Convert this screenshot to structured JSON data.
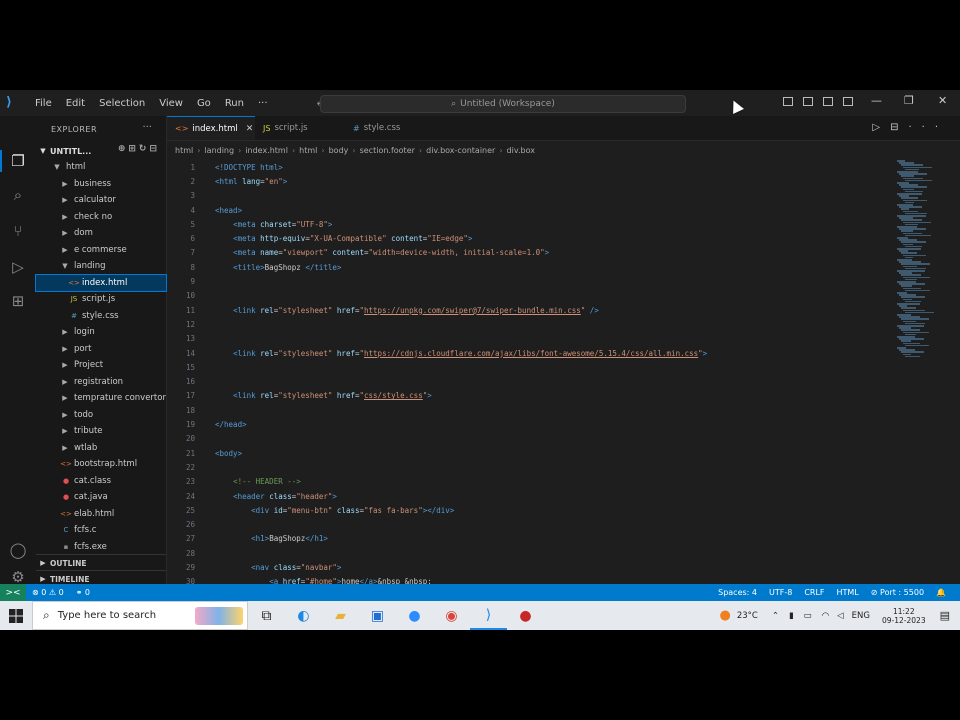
{
  "titlebar": {
    "menu": [
      "File",
      "Edit",
      "Selection",
      "View",
      "Go",
      "Run",
      "···"
    ],
    "command_center": "Untitled (Workspace)",
    "nav_back": "←",
    "nav_fwd": "→"
  },
  "sidebar": {
    "title": "EXPLORER",
    "more": "···",
    "workspace": "UNTITL...",
    "tree": [
      {
        "label": "html",
        "indent": 1,
        "kind": "folder-open"
      },
      {
        "label": "business",
        "indent": 2,
        "kind": "folder"
      },
      {
        "label": "calculator",
        "indent": 2,
        "kind": "folder"
      },
      {
        "label": "check no",
        "indent": 2,
        "kind": "folder"
      },
      {
        "label": "dom",
        "indent": 2,
        "kind": "folder"
      },
      {
        "label": "e commerse",
        "indent": 2,
        "kind": "folder"
      },
      {
        "label": "landing",
        "indent": 2,
        "kind": "folder-open"
      },
      {
        "label": "index.html",
        "indent": 3,
        "kind": "html",
        "selected": true
      },
      {
        "label": "script.js",
        "indent": 3,
        "kind": "js"
      },
      {
        "label": "style.css",
        "indent": 3,
        "kind": "css"
      },
      {
        "label": "login",
        "indent": 2,
        "kind": "folder"
      },
      {
        "label": "port",
        "indent": 2,
        "kind": "folder"
      },
      {
        "label": "Project",
        "indent": 2,
        "kind": "folder"
      },
      {
        "label": "registration",
        "indent": 2,
        "kind": "folder"
      },
      {
        "label": "temprature convertor",
        "indent": 2,
        "kind": "folder"
      },
      {
        "label": "todo",
        "indent": 2,
        "kind": "folder"
      },
      {
        "label": "tribute",
        "indent": 2,
        "kind": "folder"
      },
      {
        "label": "wtlab",
        "indent": 2,
        "kind": "folder"
      },
      {
        "label": "bootstrap.html",
        "indent": 2,
        "kind": "html"
      },
      {
        "label": "cat.class",
        "indent": 2,
        "kind": "class"
      },
      {
        "label": "cat.java",
        "indent": 2,
        "kind": "java"
      },
      {
        "label": "elab.html",
        "indent": 2,
        "kind": "html"
      },
      {
        "label": "fcfs.c",
        "indent": 2,
        "kind": "c"
      },
      {
        "label": "fcfs.exe",
        "indent": 2,
        "kind": "exe"
      }
    ],
    "outline": "OUTLINE",
    "timeline": "TIMELINE"
  },
  "tabs": [
    {
      "label": "index.html",
      "icon": "<>",
      "active": true
    },
    {
      "label": "script.js",
      "icon": "JS",
      "active": false
    },
    {
      "label": "style.css",
      "icon": "#",
      "active": false
    }
  ],
  "breadcrumb": [
    "html",
    "landing",
    "index.html",
    "html",
    "body",
    "section.footer",
    "div.box-container",
    "div.box"
  ],
  "code_lines": [
    {
      "n": "1",
      "html": "<span class='tag'>&lt;!DOCTYPE html&gt;</span>"
    },
    {
      "n": "2",
      "html": "<span class='tag'>&lt;html</span> <span class='attr'>lang</span>=<span class='str'>\"en\"</span><span class='tag'>&gt;</span>"
    },
    {
      "n": "3",
      "html": ""
    },
    {
      "n": "4",
      "html": "<span class='tag'>&lt;head&gt;</span>"
    },
    {
      "n": "5",
      "html": "    <span class='tag'>&lt;meta</span> <span class='attr'>charset</span>=<span class='str'>\"UTF-8\"</span><span class='tag'>&gt;</span>"
    },
    {
      "n": "6",
      "html": "    <span class='tag'>&lt;meta</span> <span class='attr'>http-equiv</span>=<span class='str'>\"X-UA-Compatible\"</span> <span class='attr'>content</span>=<span class='str'>\"IE=edge\"</span><span class='tag'>&gt;</span>"
    },
    {
      "n": "7",
      "html": "    <span class='tag'>&lt;meta</span> <span class='attr'>name</span>=<span class='str'>\"viewport\"</span> <span class='attr'>content</span>=<span class='str'>\"width=device-width, initial-scale=1.0\"</span><span class='tag'>&gt;</span>"
    },
    {
      "n": "8",
      "html": "    <span class='tag'>&lt;title&gt;</span>BagShopz <span class='tag'>&lt;/title&gt;</span>"
    },
    {
      "n": "9",
      "html": ""
    },
    {
      "n": "10",
      "html": ""
    },
    {
      "n": "11",
      "html": "    <span class='tag'>&lt;link</span> <span class='attr'>rel</span>=<span class='str'>\"stylesheet\"</span> <span class='attr'>href</span>=<span class='str'>\"</span><span class='url'>https://unpkg.com/swiper@7/swiper-bundle.min.css</span><span class='str'>\"</span> <span class='tag'>/&gt;</span>"
    },
    {
      "n": "12",
      "html": ""
    },
    {
      "n": "13",
      "html": ""
    },
    {
      "n": "14",
      "html": "    <span class='tag'>&lt;link</span> <span class='attr'>rel</span>=<span class='str'>\"stylesheet\"</span> <span class='attr'>href</span>=<span class='str'>\"</span><span class='url'>https://cdnjs.cloudflare.com/ajax/libs/font-awesome/5.15.4/css/all.min.css</span><span class='str'>\"</span><span class='tag'>&gt;</span>"
    },
    {
      "n": "15",
      "html": ""
    },
    {
      "n": "16",
      "html": ""
    },
    {
      "n": "17",
      "html": "    <span class='tag'>&lt;link</span> <span class='attr'>rel</span>=<span class='str'>\"stylesheet\"</span> <span class='attr'>href</span>=<span class='str'>\"</span><span class='url'>css/style.css</span><span class='str'>\"</span><span class='tag'>&gt;</span>"
    },
    {
      "n": "18",
      "html": ""
    },
    {
      "n": "19",
      "html": "<span class='tag'>&lt;/head&gt;</span>"
    },
    {
      "n": "20",
      "html": ""
    },
    {
      "n": "21",
      "html": "<span class='tag'>&lt;body&gt;</span>"
    },
    {
      "n": "22",
      "html": ""
    },
    {
      "n": "23",
      "html": "    <span class='com'>&lt;!-- HEADER --&gt;</span>"
    },
    {
      "n": "24",
      "html": "    <span class='tag'>&lt;header</span> <span class='attr'>class</span>=<span class='str'>\"header\"</span><span class='tag'>&gt;</span>"
    },
    {
      "n": "25",
      "html": "        <span class='tag'>&lt;div</span> <span class='attr'>id</span>=<span class='str'>\"menu-btn\"</span> <span class='attr'>class</span>=<span class='str'>\"fas fa-bars\"</span><span class='tag'>&gt;&lt;/div&gt;</span>"
    },
    {
      "n": "26",
      "html": ""
    },
    {
      "n": "27",
      "html": "        <span class='tag'>&lt;h1&gt;</span>BagShopz<span class='tag'>&lt;/h1&gt;</span>"
    },
    {
      "n": "28",
      "html": ""
    },
    {
      "n": "29",
      "html": "        <span class='tag'>&lt;nav</span> <span class='attr'>class</span>=<span class='str'>\"navbar\"</span><span class='tag'>&gt;</span>"
    },
    {
      "n": "30",
      "html": "            <span class='tag'>&lt;a</span> <span class='attr'>href</span>=<span class='str'>\"#home\"</span><span class='tag'>&gt;</span>home<span class='tag'>&lt;/a&gt;</span>&amp;nbsp &amp;nbsp;"
    }
  ],
  "statusbar": {
    "remote": "><",
    "problems": "⊗ 0 ⚠ 0",
    "ports": "⚭ 0",
    "spaces": "Spaces: 4",
    "encoding": "UTF-8",
    "eol": "CRLF",
    "language": "HTML",
    "port": "⊘ Port : 5500",
    "bell": "🔔"
  },
  "taskbar": {
    "search_placeholder": "Type here to search",
    "weather": "23°C",
    "lang": "ENG",
    "time": "11:22",
    "date": "09-12-2023"
  },
  "colors": {
    "accent": "#007acc",
    "selection": "#04395e",
    "editor_bg": "#1e1e1e",
    "sidebar_bg": "#181818"
  }
}
